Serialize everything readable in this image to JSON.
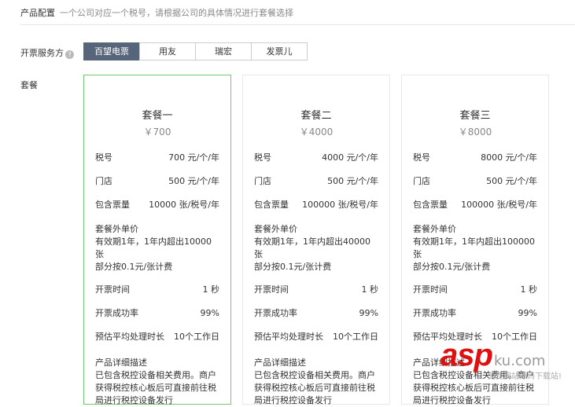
{
  "header": {
    "title": "产品配置",
    "subtitle": "一个公司对应一个税号，请根据公司的具体情况进行套餐选择"
  },
  "provider": {
    "label": "开票服务方",
    "help_icon": "?",
    "tabs": [
      "百望电票",
      "用友",
      "瑞宏",
      "发票儿"
    ],
    "selected": 0
  },
  "packages_label": "套餐",
  "packages": [
    {
      "name": "套餐一",
      "price": "￥700",
      "tax_label": "税号",
      "tax": "700 元/个/年",
      "store_label": "门店",
      "store": "500 元/个/年",
      "quota_label": "包含票量",
      "quota": "10000 张/税号/年",
      "extra_title": "套餐外单价",
      "extra_line1": "有效期1年，1年内超出10000张",
      "extra_line2": "部分按0.1元/张计费",
      "time_label": "开票时间",
      "time": "1 秒",
      "rate_label": "开票成功率",
      "rate": "99%",
      "proc_label": "预估平均处理时长",
      "proc": "10个工作日",
      "desc_title": "产品详细描述",
      "desc": "已包含税控设备相关费用。商户获得税控核心板后可直接前往税局进行税控设备发行"
    },
    {
      "name": "套餐二",
      "price": "￥4000",
      "tax_label": "税号",
      "tax": "4000 元/个/年",
      "store_label": "门店",
      "store": "500 元/个/年",
      "quota_label": "包含票量",
      "quota": "100000 张/税号/年",
      "extra_title": "套餐外单价",
      "extra_line1": "有效期1年，1年内超出40000张",
      "extra_line2": "部分按0.1元/张计费",
      "time_label": "开票时间",
      "time": "1 秒",
      "rate_label": "开票成功率",
      "rate": "99%",
      "proc_label": "预估平均处理时长",
      "proc": "10个工作日",
      "desc_title": "产品详细描述",
      "desc": "已包含税控设备相关费用。商户获得税控核心板后可直接前往税局进行税控设备发行"
    },
    {
      "name": "套餐三",
      "price": "￥8000",
      "tax_label": "税号",
      "tax": "8000 元/个/年",
      "store_label": "门店",
      "store": "500 元/个/年",
      "quota_label": "包含票量",
      "quota": "100000 张/税号/年",
      "extra_title": "套餐外单价",
      "extra_line1": "有效期1年，1年内超出100000张",
      "extra_line2": "部分按0.1元/张计费",
      "time_label": "开票时间",
      "time": "1 秒",
      "rate_label": "开票成功率",
      "rate": "99%",
      "proc_label": "预估平均处理时长",
      "proc": "10个工作日",
      "desc_title": "产品详细描述",
      "desc": "已包含税控设备相关费用。商户获得税控核心板后可直接前往税局进行税控设备发行"
    }
  ],
  "watermark": {
    "brand": "asp",
    "suffix": "ku.com",
    "slogan": "免费网站源码下载站!"
  }
}
